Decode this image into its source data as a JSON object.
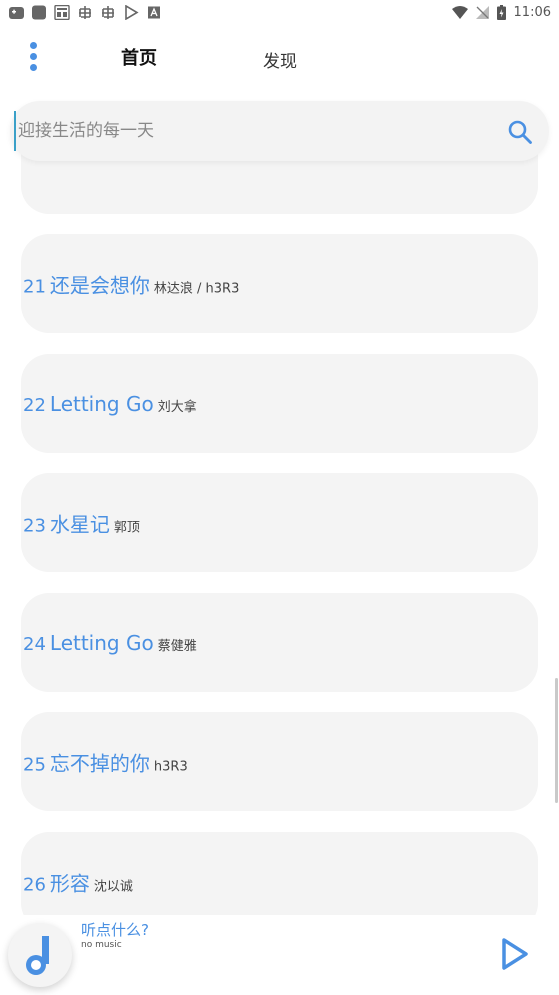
{
  "status_bar": {
    "time": "11:06"
  },
  "header": {
    "tabs": [
      {
        "label": "首页",
        "active": true
      },
      {
        "label": "发现",
        "active": false
      }
    ]
  },
  "search": {
    "placeholder": "迎接生活的每一天"
  },
  "songs": [
    {
      "num": "21",
      "title": "还是会想你",
      "artist": "林达浪 / h3R3"
    },
    {
      "num": "22",
      "title": "Letting Go",
      "artist": "刘大拿"
    },
    {
      "num": "23",
      "title": "水星记",
      "artist": "郭顶"
    },
    {
      "num": "24",
      "title": "Letting Go",
      "artist": "蔡健雅"
    },
    {
      "num": "25",
      "title": "忘不掉的你",
      "artist": "h3R3"
    },
    {
      "num": "26",
      "title": "形容",
      "artist": "沈以诚"
    }
  ],
  "player": {
    "title": "听点什么?",
    "subtitle": "no music"
  },
  "colors": {
    "accent": "#4a90e2",
    "card": "#f4f4f4"
  },
  "icons": {
    "menu": "vertical-dots-icon",
    "search": "search-icon",
    "music": "music-note-icon",
    "play": "play-icon"
  }
}
